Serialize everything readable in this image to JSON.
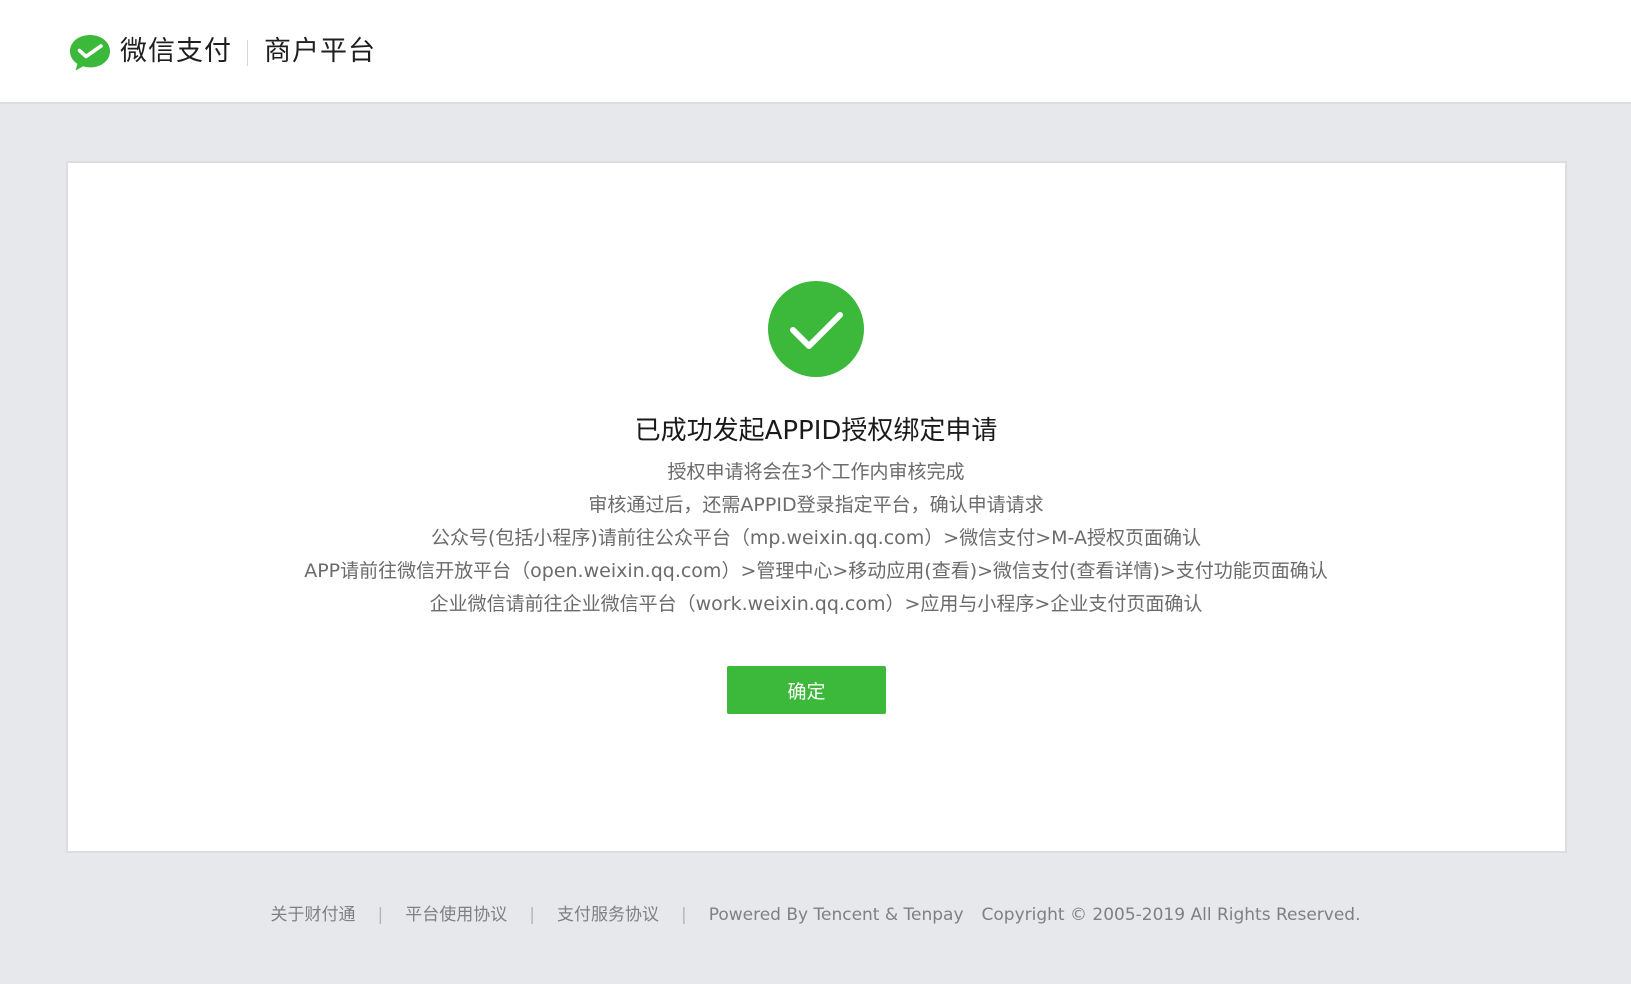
{
  "header": {
    "brand": "微信支付",
    "platform": "商户平台"
  },
  "result": {
    "title": "已成功发起APPID授权绑定申请",
    "lines": [
      "授权申请将会在3个工作内审核完成",
      "审核通过后，还需APPID登录指定平台，确认申请请求",
      "公众号(包括小程序)请前往公众平台（mp.weixin.qq.com）>微信支付>M-A授权页面确认",
      "APP请前往微信开放平台（open.weixin.qq.com）>管理中心>移动应用(查看)>微信支付(查看详情)>支付功能页面确认",
      "企业微信请前往企业微信平台（work.weixin.qq.com）>应用与小程序>企业支付页面确认"
    ],
    "confirm_label": "确定"
  },
  "footer": {
    "links": [
      "关于财付通",
      "平台使用协议",
      "支付服务协议"
    ],
    "separator": "|",
    "powered": "Powered By Tencent & Tenpay",
    "copyright": "Copyright © 2005-2019 All Rights Reserved."
  },
  "colors": {
    "accent": "#3cb83a",
    "background": "#e7e8eb"
  },
  "icons": {
    "logo": "wechat-pay-logo-icon",
    "status": "check-circle-icon"
  }
}
